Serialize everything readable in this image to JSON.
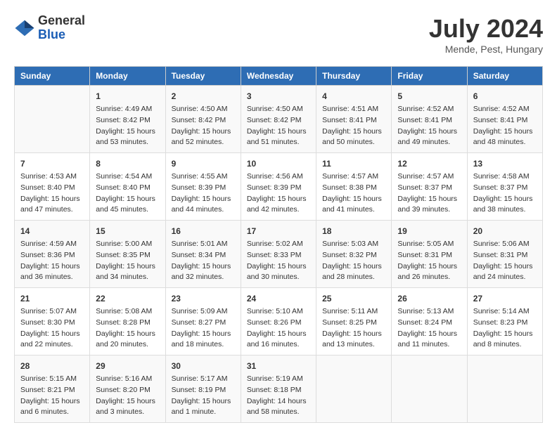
{
  "logo": {
    "general": "General",
    "blue": "Blue"
  },
  "title": "July 2024",
  "subtitle": "Mende, Pest, Hungary",
  "days": [
    "Sunday",
    "Monday",
    "Tuesday",
    "Wednesday",
    "Thursday",
    "Friday",
    "Saturday"
  ],
  "weeks": [
    [
      {
        "day": "",
        "sunrise": "",
        "sunset": "",
        "daylight": ""
      },
      {
        "day": "1",
        "sunrise": "Sunrise: 4:49 AM",
        "sunset": "Sunset: 8:42 PM",
        "daylight": "Daylight: 15 hours and 53 minutes."
      },
      {
        "day": "2",
        "sunrise": "Sunrise: 4:50 AM",
        "sunset": "Sunset: 8:42 PM",
        "daylight": "Daylight: 15 hours and 52 minutes."
      },
      {
        "day": "3",
        "sunrise": "Sunrise: 4:50 AM",
        "sunset": "Sunset: 8:42 PM",
        "daylight": "Daylight: 15 hours and 51 minutes."
      },
      {
        "day": "4",
        "sunrise": "Sunrise: 4:51 AM",
        "sunset": "Sunset: 8:41 PM",
        "daylight": "Daylight: 15 hours and 50 minutes."
      },
      {
        "day": "5",
        "sunrise": "Sunrise: 4:52 AM",
        "sunset": "Sunset: 8:41 PM",
        "daylight": "Daylight: 15 hours and 49 minutes."
      },
      {
        "day": "6",
        "sunrise": "Sunrise: 4:52 AM",
        "sunset": "Sunset: 8:41 PM",
        "daylight": "Daylight: 15 hours and 48 minutes."
      }
    ],
    [
      {
        "day": "7",
        "sunrise": "Sunrise: 4:53 AM",
        "sunset": "Sunset: 8:40 PM",
        "daylight": "Daylight: 15 hours and 47 minutes."
      },
      {
        "day": "8",
        "sunrise": "Sunrise: 4:54 AM",
        "sunset": "Sunset: 8:40 PM",
        "daylight": "Daylight: 15 hours and 45 minutes."
      },
      {
        "day": "9",
        "sunrise": "Sunrise: 4:55 AM",
        "sunset": "Sunset: 8:39 PM",
        "daylight": "Daylight: 15 hours and 44 minutes."
      },
      {
        "day": "10",
        "sunrise": "Sunrise: 4:56 AM",
        "sunset": "Sunset: 8:39 PM",
        "daylight": "Daylight: 15 hours and 42 minutes."
      },
      {
        "day": "11",
        "sunrise": "Sunrise: 4:57 AM",
        "sunset": "Sunset: 8:38 PM",
        "daylight": "Daylight: 15 hours and 41 minutes."
      },
      {
        "day": "12",
        "sunrise": "Sunrise: 4:57 AM",
        "sunset": "Sunset: 8:37 PM",
        "daylight": "Daylight: 15 hours and 39 minutes."
      },
      {
        "day": "13",
        "sunrise": "Sunrise: 4:58 AM",
        "sunset": "Sunset: 8:37 PM",
        "daylight": "Daylight: 15 hours and 38 minutes."
      }
    ],
    [
      {
        "day": "14",
        "sunrise": "Sunrise: 4:59 AM",
        "sunset": "Sunset: 8:36 PM",
        "daylight": "Daylight: 15 hours and 36 minutes."
      },
      {
        "day": "15",
        "sunrise": "Sunrise: 5:00 AM",
        "sunset": "Sunset: 8:35 PM",
        "daylight": "Daylight: 15 hours and 34 minutes."
      },
      {
        "day": "16",
        "sunrise": "Sunrise: 5:01 AM",
        "sunset": "Sunset: 8:34 PM",
        "daylight": "Daylight: 15 hours and 32 minutes."
      },
      {
        "day": "17",
        "sunrise": "Sunrise: 5:02 AM",
        "sunset": "Sunset: 8:33 PM",
        "daylight": "Daylight: 15 hours and 30 minutes."
      },
      {
        "day": "18",
        "sunrise": "Sunrise: 5:03 AM",
        "sunset": "Sunset: 8:32 PM",
        "daylight": "Daylight: 15 hours and 28 minutes."
      },
      {
        "day": "19",
        "sunrise": "Sunrise: 5:05 AM",
        "sunset": "Sunset: 8:31 PM",
        "daylight": "Daylight: 15 hours and 26 minutes."
      },
      {
        "day": "20",
        "sunrise": "Sunrise: 5:06 AM",
        "sunset": "Sunset: 8:31 PM",
        "daylight": "Daylight: 15 hours and 24 minutes."
      }
    ],
    [
      {
        "day": "21",
        "sunrise": "Sunrise: 5:07 AM",
        "sunset": "Sunset: 8:30 PM",
        "daylight": "Daylight: 15 hours and 22 minutes."
      },
      {
        "day": "22",
        "sunrise": "Sunrise: 5:08 AM",
        "sunset": "Sunset: 8:28 PM",
        "daylight": "Daylight: 15 hours and 20 minutes."
      },
      {
        "day": "23",
        "sunrise": "Sunrise: 5:09 AM",
        "sunset": "Sunset: 8:27 PM",
        "daylight": "Daylight: 15 hours and 18 minutes."
      },
      {
        "day": "24",
        "sunrise": "Sunrise: 5:10 AM",
        "sunset": "Sunset: 8:26 PM",
        "daylight": "Daylight: 15 hours and 16 minutes."
      },
      {
        "day": "25",
        "sunrise": "Sunrise: 5:11 AM",
        "sunset": "Sunset: 8:25 PM",
        "daylight": "Daylight: 15 hours and 13 minutes."
      },
      {
        "day": "26",
        "sunrise": "Sunrise: 5:13 AM",
        "sunset": "Sunset: 8:24 PM",
        "daylight": "Daylight: 15 hours and 11 minutes."
      },
      {
        "day": "27",
        "sunrise": "Sunrise: 5:14 AM",
        "sunset": "Sunset: 8:23 PM",
        "daylight": "Daylight: 15 hours and 8 minutes."
      }
    ],
    [
      {
        "day": "28",
        "sunrise": "Sunrise: 5:15 AM",
        "sunset": "Sunset: 8:21 PM",
        "daylight": "Daylight: 15 hours and 6 minutes."
      },
      {
        "day": "29",
        "sunrise": "Sunrise: 5:16 AM",
        "sunset": "Sunset: 8:20 PM",
        "daylight": "Daylight: 15 hours and 3 minutes."
      },
      {
        "day": "30",
        "sunrise": "Sunrise: 5:17 AM",
        "sunset": "Sunset: 8:19 PM",
        "daylight": "Daylight: 15 hours and 1 minute."
      },
      {
        "day": "31",
        "sunrise": "Sunrise: 5:19 AM",
        "sunset": "Sunset: 8:18 PM",
        "daylight": "Daylight: 14 hours and 58 minutes."
      },
      {
        "day": "",
        "sunrise": "",
        "sunset": "",
        "daylight": ""
      },
      {
        "day": "",
        "sunrise": "",
        "sunset": "",
        "daylight": ""
      },
      {
        "day": "",
        "sunrise": "",
        "sunset": "",
        "daylight": ""
      }
    ]
  ]
}
